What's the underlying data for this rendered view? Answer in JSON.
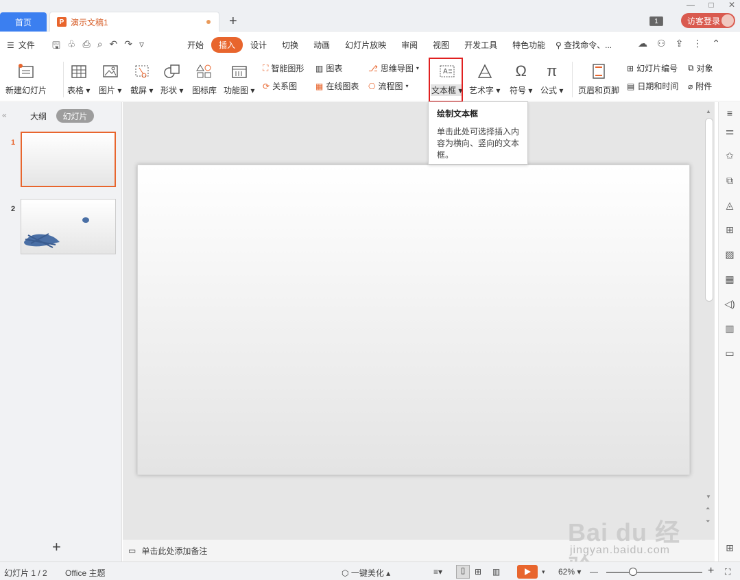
{
  "titlebar": {
    "home_tab": "首页",
    "doc_tab_title": "演示文稿1",
    "new_tab": "+",
    "pages_badge": "1",
    "login": "访客登录"
  },
  "menubar": {
    "file": "文件",
    "tabs": [
      "开始",
      "插入",
      "设计",
      "切换",
      "动画",
      "幻灯片放映",
      "审阅",
      "视图",
      "开发工具",
      "特色功能"
    ],
    "active_tab": "插入",
    "search": "查找命令、..."
  },
  "ribbon": {
    "new_slide": "新建幻灯片",
    "table": "表格",
    "picture": "图片",
    "screenshot": "截屏",
    "shape": "形状",
    "icon_lib": "图标库",
    "function_chart": "功能图",
    "smart_art": "智能图形",
    "chart": "图表",
    "relation": "关系图",
    "online_chart": "在线图表",
    "mind_map": "思维导图",
    "flowchart": "流程图",
    "text_box": "文本框",
    "word_art": "艺术字",
    "symbol": "符号",
    "formula": "公式",
    "header_footer": "页眉和页脚",
    "slide_number": "幻灯片编号",
    "object": "对象",
    "datetime": "日期和时间",
    "attachment": "附件"
  },
  "tooltip": {
    "title": "绘制文本框",
    "desc": "单击此处可选择插入内容为横向、竖向的文本框。"
  },
  "leftpanel": {
    "outline": "大纲",
    "slides": "幻灯片",
    "thumbs": [
      "1",
      "2"
    ],
    "add": "+"
  },
  "notes": {
    "placeholder": "单击此处添加备注"
  },
  "statusbar": {
    "slide_info": "幻灯片 1 / 2",
    "theme": "Office 主题",
    "beautify": "一键美化",
    "zoom": "62%"
  },
  "watermark": {
    "brand": "Bai  du 经验",
    "sub": "jingyan.baidu.com"
  },
  "colors": {
    "accent": "#e8652d",
    "home_tab": "#3b7ff0",
    "highlight_box": "#e02020"
  }
}
